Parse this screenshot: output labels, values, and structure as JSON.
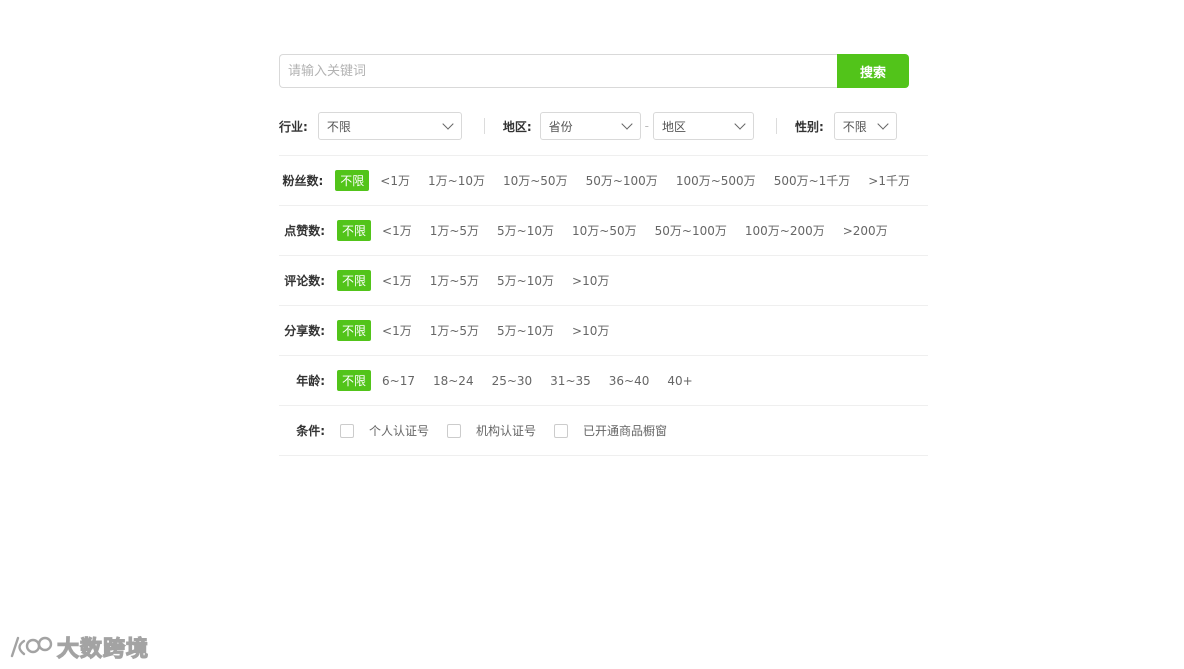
{
  "search": {
    "placeholder": "请输入关键词",
    "button_label": "搜索"
  },
  "selects": {
    "industry_label": "行业:",
    "industry_value": "不限",
    "region_label": "地区:",
    "province_value": "省份",
    "region_sep": "-",
    "district_value": "地区",
    "gender_label": "性别:",
    "gender_value": "不限"
  },
  "filters": {
    "fans": {
      "label": "粉丝数:",
      "options": [
        "不限",
        "<1万",
        "1万~10万",
        "10万~50万",
        "50万~100万",
        "100万~500万",
        "500万~1千万",
        ">1千万"
      ]
    },
    "likes": {
      "label": "点赞数:",
      "options": [
        "不限",
        "<1万",
        "1万~5万",
        "5万~10万",
        "10万~50万",
        "50万~100万",
        "100万~200万",
        ">200万"
      ]
    },
    "comments": {
      "label": "评论数:",
      "options": [
        "不限",
        "<1万",
        "1万~5万",
        "5万~10万",
        ">10万"
      ]
    },
    "shares": {
      "label": "分享数:",
      "options": [
        "不限",
        "<1万",
        "1万~5万",
        "5万~10万",
        ">10万"
      ]
    },
    "age": {
      "label": "年龄:",
      "options": [
        "不限",
        "6~17",
        "18~24",
        "25~30",
        "31~35",
        "36~40",
        "40+"
      ]
    }
  },
  "conditions": {
    "label": "条件:",
    "items": [
      "个人认证号",
      "机构认证号",
      "已开通商品橱窗"
    ]
  },
  "watermark": {
    "text": "大数跨境"
  },
  "colors": {
    "accent": "#52c41a",
    "border": "#d9d9d9",
    "divider": "#efefef"
  }
}
